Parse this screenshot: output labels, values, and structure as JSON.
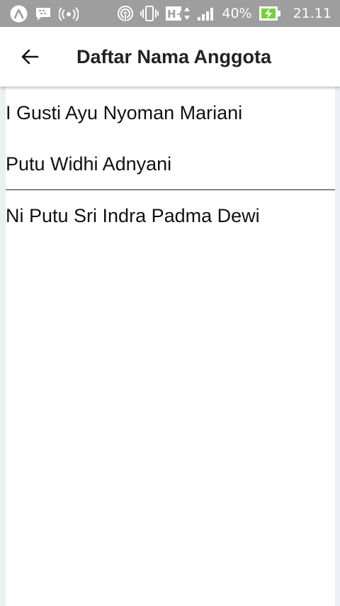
{
  "status_bar": {
    "battery": "40%",
    "time": "21.11",
    "network": "H+",
    "icons": [
      "app-logo-icon",
      "bbm-icon",
      "broadcast-icon",
      "hotspot-icon",
      "vibrate-icon",
      "network-type-icon",
      "signal-icon",
      "battery-charging-icon"
    ],
    "battery_color": "#76d13a"
  },
  "app_bar": {
    "title": "Daftar Nama Anggota",
    "back_icon": "arrow-left-icon"
  },
  "members": [
    "I Gusti Ayu Nyoman Mariani",
    "Putu Widhi Adnyani",
    "Ni Putu Sri Indra Padma Dewi"
  ]
}
